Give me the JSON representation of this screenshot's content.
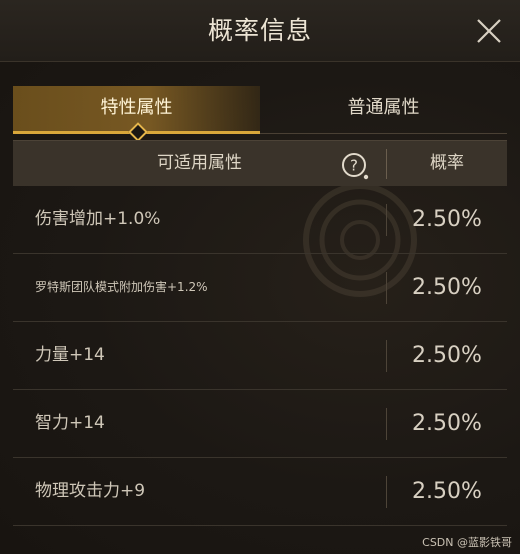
{
  "dialog": {
    "title": "概率信息"
  },
  "tabs": [
    {
      "label": "特性属性",
      "active": true
    },
    {
      "label": "普通属性",
      "active": false
    }
  ],
  "table": {
    "headers": {
      "attribute": "可适用属性",
      "probability": "概率"
    },
    "rows": [
      {
        "name": "伤害增加+1.0%",
        "probability": "2.50%"
      },
      {
        "name": "罗特斯团队模式附加伤害+1.2%",
        "probability": "2.50%"
      },
      {
        "name": "力量+14",
        "probability": "2.50%"
      },
      {
        "name": "智力+14",
        "probability": "2.50%"
      },
      {
        "name": "物理攻击力+9",
        "probability": "2.50%"
      }
    ]
  },
  "watermark": "CSDN @蓝影铁哥",
  "colors": {
    "accent": "#d9a73a",
    "background": "#1b1713",
    "header_row": "#3a332a"
  }
}
